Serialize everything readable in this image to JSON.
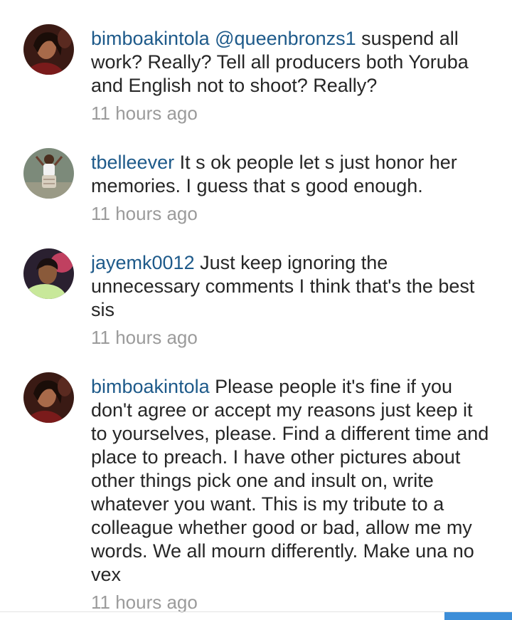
{
  "comments": [
    {
      "username": "bimboakintola",
      "mention": "@queenbronzs1",
      "text": " suspend all work? Really? Tell all producers both Yoruba and English not to shoot? Really?",
      "time": "11 hours ago",
      "avatar": "avatar-woman-red-dark"
    },
    {
      "username": "tbelleever",
      "mention": "",
      "text": " It s ok people let s just honor her memories. I guess that s good enough.",
      "time": "11 hours ago",
      "avatar": "avatar-woman-standing"
    },
    {
      "username": "jayemk0012",
      "mention": "",
      "text": " Just keep ignoring the unnecessary comments I think that's the best sis",
      "time": "11 hours ago",
      "avatar": "avatar-woman-pink"
    },
    {
      "username": "bimboakintola",
      "mention": "",
      "text": " Please people it's fine if you don't agree or accept my reasons just keep it to yourselves, please. Find a different time and place to preach. I have other pictures about other things pick one and insult on, write whatever you want. This is my tribute to a colleague whether good or bad, allow me my words. We all mourn differently. Make una no vex",
      "time": "11 hours ago",
      "avatar": "avatar-woman-red-dark"
    }
  ],
  "colors": {
    "username": "#1e5a8a",
    "body_text": "#262626",
    "timestamp": "#9b9b9b",
    "scroll_indicator": "#3d8ed8"
  }
}
